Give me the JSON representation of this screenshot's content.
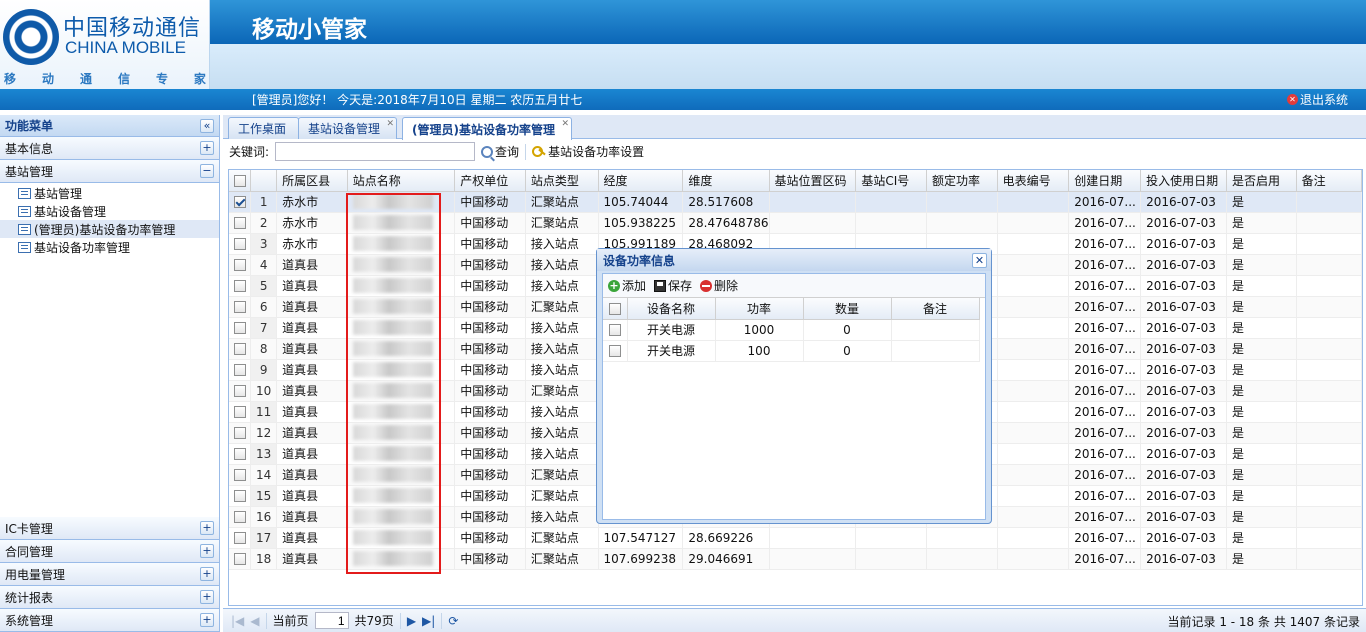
{
  "app": {
    "title": "移动小管家"
  },
  "logo": {
    "cn": "中国移动通信",
    "en": "CHINA MOBILE",
    "slogan": [
      "移",
      "动",
      "通",
      "信",
      "专",
      "家"
    ]
  },
  "header": {
    "greeting": "[管理员]您好！ 今天是:2018年7月10日 星期二 农历五月廿七",
    "logout_label": "退出系统"
  },
  "sidebar": {
    "title": "功能菜单",
    "collapse_glyph": "«",
    "sections": [
      {
        "label": "基本信息",
        "toggle": "+"
      },
      {
        "label": "基站管理",
        "toggle": "−"
      }
    ],
    "tree_items": [
      "基站管理",
      "基站设备管理",
      "(管理员)基站设备功率管理",
      "基站设备功率管理"
    ],
    "bottom_sections": [
      "IC卡管理",
      "合同管理",
      "用电量管理",
      "统计报表",
      "系统管理"
    ]
  },
  "tabs": [
    {
      "label": "工作桌面"
    },
    {
      "label": "基站设备管理"
    },
    {
      "label": "(管理员)基站设备功率管理"
    }
  ],
  "toolbar": {
    "keyword_label": "关键词:",
    "keyword_value": "",
    "search_label": "查询",
    "power_setting_label": "基站设备功率设置"
  },
  "grid": {
    "columns": [
      "所属区县",
      "站点名称",
      "产权单位",
      "站点类型",
      "经度",
      "维度",
      "基站位置区码",
      "基站CI号",
      "额定功率",
      "电表编号",
      "创建日期",
      "投入使用日期",
      "是否启用",
      "备注"
    ],
    "rows": [
      {
        "n": "1",
        "county": "赤水市",
        "owner": "中国移动",
        "type": "汇聚站点",
        "lon": "105.74044",
        "lat": "28.517608",
        "created": "2016-07...",
        "used": "2016-07-03",
        "enabled": "是",
        "checked": true
      },
      {
        "n": "2",
        "county": "赤水市",
        "owner": "中国移动",
        "type": "汇聚站点",
        "lon": "105.938225",
        "lat": "28.47648786",
        "created": "2016-07...",
        "used": "2016-07-03",
        "enabled": "是"
      },
      {
        "n": "3",
        "county": "赤水市",
        "owner": "中国移动",
        "type": "接入站点",
        "lon": "105.991189",
        "lat": "28.468092",
        "created": "2016-07...",
        "used": "2016-07-03",
        "enabled": "是"
      },
      {
        "n": "4",
        "county": "道真县",
        "owner": "中国移动",
        "type": "接入站点",
        "lon": "",
        "lat": "",
        "created": "2016-07...",
        "used": "2016-07-03",
        "enabled": "是"
      },
      {
        "n": "5",
        "county": "道真县",
        "owner": "中国移动",
        "type": "接入站点",
        "lon": "",
        "lat": "",
        "created": "2016-07...",
        "used": "2016-07-03",
        "enabled": "是"
      },
      {
        "n": "6",
        "county": "道真县",
        "owner": "中国移动",
        "type": "汇聚站点",
        "lon": "",
        "lat": "",
        "created": "2016-07...",
        "used": "2016-07-03",
        "enabled": "是"
      },
      {
        "n": "7",
        "county": "道真县",
        "owner": "中国移动",
        "type": "接入站点",
        "lon": "",
        "lat": "",
        "created": "2016-07...",
        "used": "2016-07-03",
        "enabled": "是"
      },
      {
        "n": "8",
        "county": "道真县",
        "owner": "中国移动",
        "type": "接入站点",
        "lon": "",
        "lat": "",
        "created": "2016-07...",
        "used": "2016-07-03",
        "enabled": "是"
      },
      {
        "n": "9",
        "county": "道真县",
        "owner": "中国移动",
        "type": "接入站点",
        "lon": "",
        "lat": "",
        "created": "2016-07...",
        "used": "2016-07-03",
        "enabled": "是"
      },
      {
        "n": "10",
        "county": "道真县",
        "owner": "中国移动",
        "type": "汇聚站点",
        "lon": "",
        "lat": "",
        "created": "2016-07...",
        "used": "2016-07-03",
        "enabled": "是"
      },
      {
        "n": "11",
        "county": "道真县",
        "owner": "中国移动",
        "type": "接入站点",
        "lon": "",
        "lat": "",
        "created": "2016-07...",
        "used": "2016-07-03",
        "enabled": "是"
      },
      {
        "n": "12",
        "county": "道真县",
        "owner": "中国移动",
        "type": "接入站点",
        "lon": "",
        "lat": "",
        "created": "2016-07...",
        "used": "2016-07-03",
        "enabled": "是"
      },
      {
        "n": "13",
        "county": "道真县",
        "owner": "中国移动",
        "type": "接入站点",
        "lon": "",
        "lat": "",
        "created": "2016-07...",
        "used": "2016-07-03",
        "enabled": "是"
      },
      {
        "n": "14",
        "county": "道真县",
        "owner": "中国移动",
        "type": "汇聚站点",
        "lon": "",
        "lat": "",
        "created": "2016-07...",
        "used": "2016-07-03",
        "enabled": "是"
      },
      {
        "n": "15",
        "county": "道真县",
        "owner": "中国移动",
        "type": "汇聚站点",
        "lon": "",
        "lat": "",
        "created": "2016-07...",
        "used": "2016-07-03",
        "enabled": "是"
      },
      {
        "n": "16",
        "county": "道真县",
        "owner": "中国移动",
        "type": "接入站点",
        "lon": "",
        "lat": "",
        "created": "2016-07...",
        "used": "2016-07-03",
        "enabled": "是"
      },
      {
        "n": "17",
        "county": "道真县",
        "owner": "中国移动",
        "type": "汇聚站点",
        "lon": "107.547127",
        "lat": "28.669226",
        "created": "2016-07...",
        "used": "2016-07-03",
        "enabled": "是"
      },
      {
        "n": "18",
        "county": "道真县",
        "owner": "中国移动",
        "type": "汇聚站点",
        "lon": "107.699238",
        "lat": "29.046691",
        "created": "2016-07...",
        "used": "2016-07-03",
        "enabled": "是"
      }
    ]
  },
  "pager": {
    "current_label": "当前页",
    "current_page": "1",
    "total_label": "共79页",
    "records": "当前记录 1 - 18 条 共 1407 条记录"
  },
  "dialog": {
    "title": "设备功率信息",
    "add_label": "添加",
    "save_label": "保存",
    "delete_label": "删除",
    "columns": [
      "设备名称",
      "功率",
      "数量",
      "备注"
    ],
    "rows": [
      {
        "name": "开关电源",
        "power": "1000",
        "qty": "0",
        "note": ""
      },
      {
        "name": "开关电源",
        "power": "100",
        "qty": "0",
        "note": ""
      }
    ]
  }
}
